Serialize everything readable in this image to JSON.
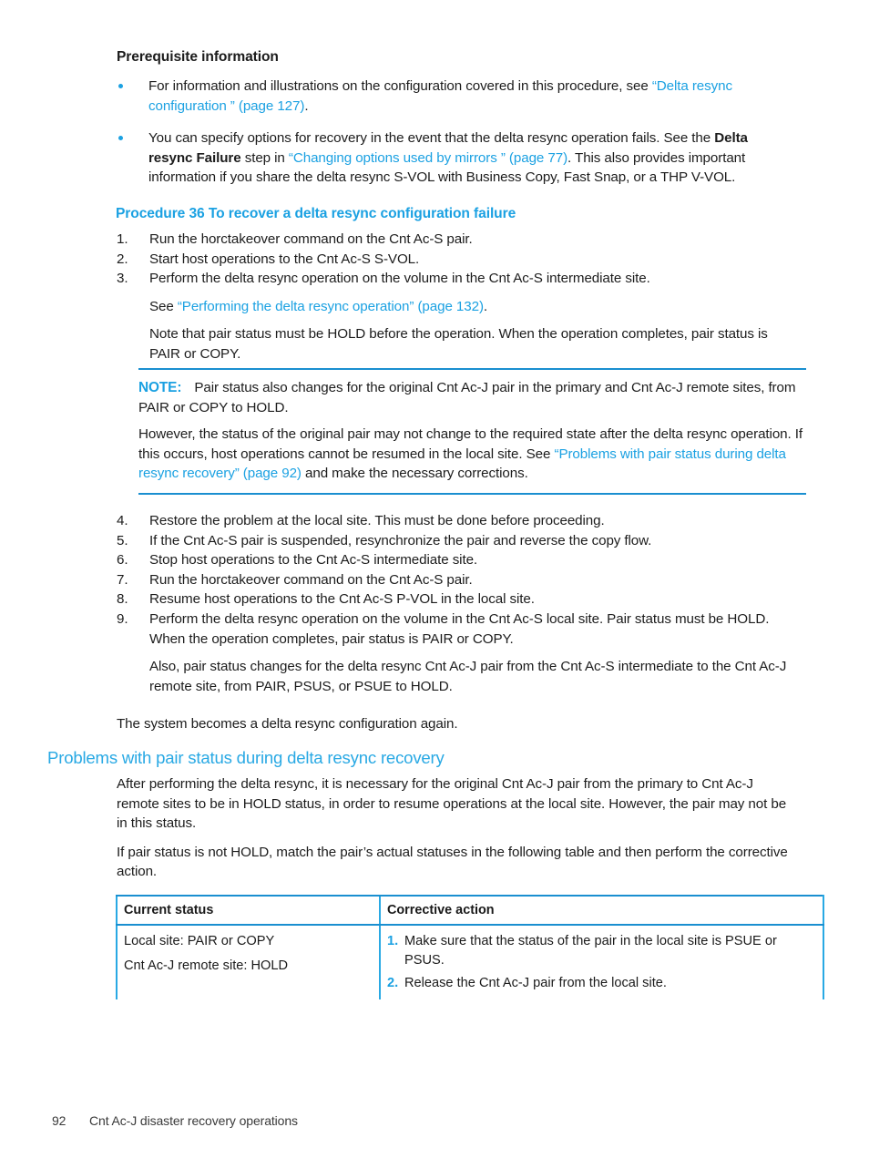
{
  "page": {
    "number": "92",
    "footer_title": "Cnt Ac-J disaster recovery operations"
  },
  "colors": {
    "link": "#1ba1e2",
    "heading_blue": "#29a9e4",
    "rule_blue": "#1a8fd0",
    "text": "#1c1c1c"
  },
  "prerequisite": {
    "heading": "Prerequisite information",
    "bullets": [
      {
        "parts": [
          {
            "text": "For information and illustrations on the configuration covered in this procedure, see ",
            "style": "plain"
          },
          {
            "text": "“Delta resync configuration ” (page 127)",
            "style": "link"
          },
          {
            "text": ".",
            "style": "plain"
          }
        ]
      },
      {
        "parts": [
          {
            "text": "You can specify options for recovery in the event that the delta resync operation fails. See the ",
            "style": "plain"
          },
          {
            "text": "Delta resync Failure",
            "style": "bold"
          },
          {
            "text": " step in ",
            "style": "plain"
          },
          {
            "text": "“Changing options used by mirrors ” (page 77)",
            "style": "link"
          },
          {
            "text": ". This also provides important information if you share the delta resync S-VOL with Business Copy, Fast Snap, or a THP V-VOL.",
            "style": "plain"
          }
        ]
      }
    ]
  },
  "procedure": {
    "heading": "Procedure 36 To recover a delta resync configuration failure",
    "steps_before_note": [
      {
        "num": "1.",
        "text": "Run the horctakeover command on the Cnt Ac-S pair."
      },
      {
        "num": "2.",
        "text": "Start host operations to the Cnt Ac-S S-VOL."
      },
      {
        "num": "3.",
        "text": "Perform the delta resync operation on the volume in the Cnt Ac-S intermediate site."
      }
    ],
    "step3_see": {
      "prefix": "See ",
      "link": "“Performing the delta resync operation” (page 132)",
      "suffix": "."
    },
    "step3_note": "Note that pair status must be HOLD before the operation. When the operation completes, pair status is PAIR or COPY.",
    "steps_after_note": [
      {
        "num": "4.",
        "text": "Restore the problem at the local site. This must be done before proceeding."
      },
      {
        "num": "5.",
        "text": "If the Cnt Ac-S pair is suspended, resynchronize the pair and reverse the copy flow."
      },
      {
        "num": "6.",
        "text": "Stop host operations to the Cnt Ac-S intermediate site."
      },
      {
        "num": "7.",
        "text": "Run the horctakeover command on the Cnt Ac-S pair."
      },
      {
        "num": "8.",
        "text": "Resume host operations to the Cnt Ac-S P-VOL in the local site."
      },
      {
        "num": "9.",
        "text": "Perform the delta resync operation on the volume in the Cnt Ac-S local site. Pair status must be HOLD. When the operation completes, pair status is PAIR or COPY."
      }
    ],
    "step9_also": "Also, pair status changes for the delta resync Cnt Ac-J pair from the Cnt Ac-S intermediate to the Cnt Ac-J remote site, from PAIR, PSUS, or PSUE to HOLD.",
    "closing": "The system becomes a delta resync configuration again."
  },
  "note": {
    "label": "NOTE:",
    "paragraph1": "Pair status also changes for the original Cnt Ac-J pair in the primary and Cnt Ac-J remote sites, from PAIR or COPY to HOLD.",
    "paragraph2_prefix": "However, the status of the original pair may not change to the required state after the delta resync operation. If this occurs, host operations cannot be resumed in the local site. See ",
    "paragraph2_link": "“Problems with pair status during delta resync recovery” (page 92)",
    "paragraph2_suffix": " and make the necessary corrections."
  },
  "section": {
    "heading": "Problems with pair status during delta resync recovery",
    "paragraph1": "After performing the delta resync, it is necessary for the original Cnt Ac-J pair from the primary to Cnt Ac-J remote sites to be in HOLD status, in order to resume operations at the local site. However, the pair may not be in this status.",
    "paragraph2": "If pair status is not HOLD, match the pair’s actual statuses in the following table and then perform the corrective action."
  },
  "table": {
    "headers": [
      "Current status",
      "Corrective action"
    ],
    "rows": [
      {
        "current_status": [
          "Local site: PAIR or COPY",
          "Cnt Ac-J remote site: HOLD"
        ],
        "corrective_action": [
          {
            "num": "1.",
            "text": "Make sure that the status of the pair in the local site is PSUE or PSUS."
          },
          {
            "num": "2.",
            "text": "Release the Cnt Ac-J pair from the local site."
          }
        ]
      }
    ]
  }
}
